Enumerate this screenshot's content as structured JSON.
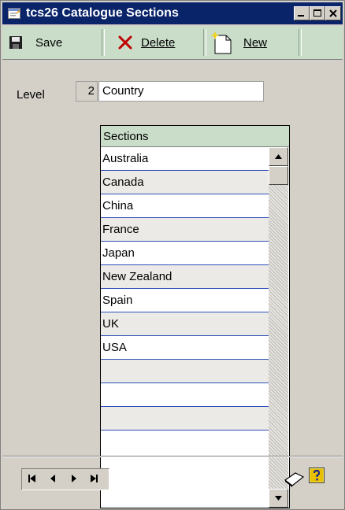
{
  "window": {
    "title": "tcs26 Catalogue Sections"
  },
  "toolbar": {
    "save_label": "Save",
    "delete_label": "Delete",
    "new_label": "New"
  },
  "level": {
    "label": "Level",
    "number": "2",
    "name": "Country"
  },
  "grid": {
    "header": "Sections",
    "rows": [
      "Australia",
      "Canada",
      "China",
      "France",
      "Japan",
      "New Zealand",
      "Spain",
      "UK",
      "USA",
      "",
      "",
      ""
    ]
  },
  "icons": [
    "app-icon",
    "minimize-icon",
    "maximize-icon",
    "close-icon",
    "save-icon",
    "delete-icon",
    "new-icon",
    "first-record-icon",
    "previous-record-icon",
    "next-record-icon",
    "last-record-icon",
    "note-icon",
    "help-icon"
  ],
  "colors": {
    "titlebar": "#0a246a",
    "toolbar": "#c9ddc9",
    "row_line": "#2e4fb8"
  }
}
